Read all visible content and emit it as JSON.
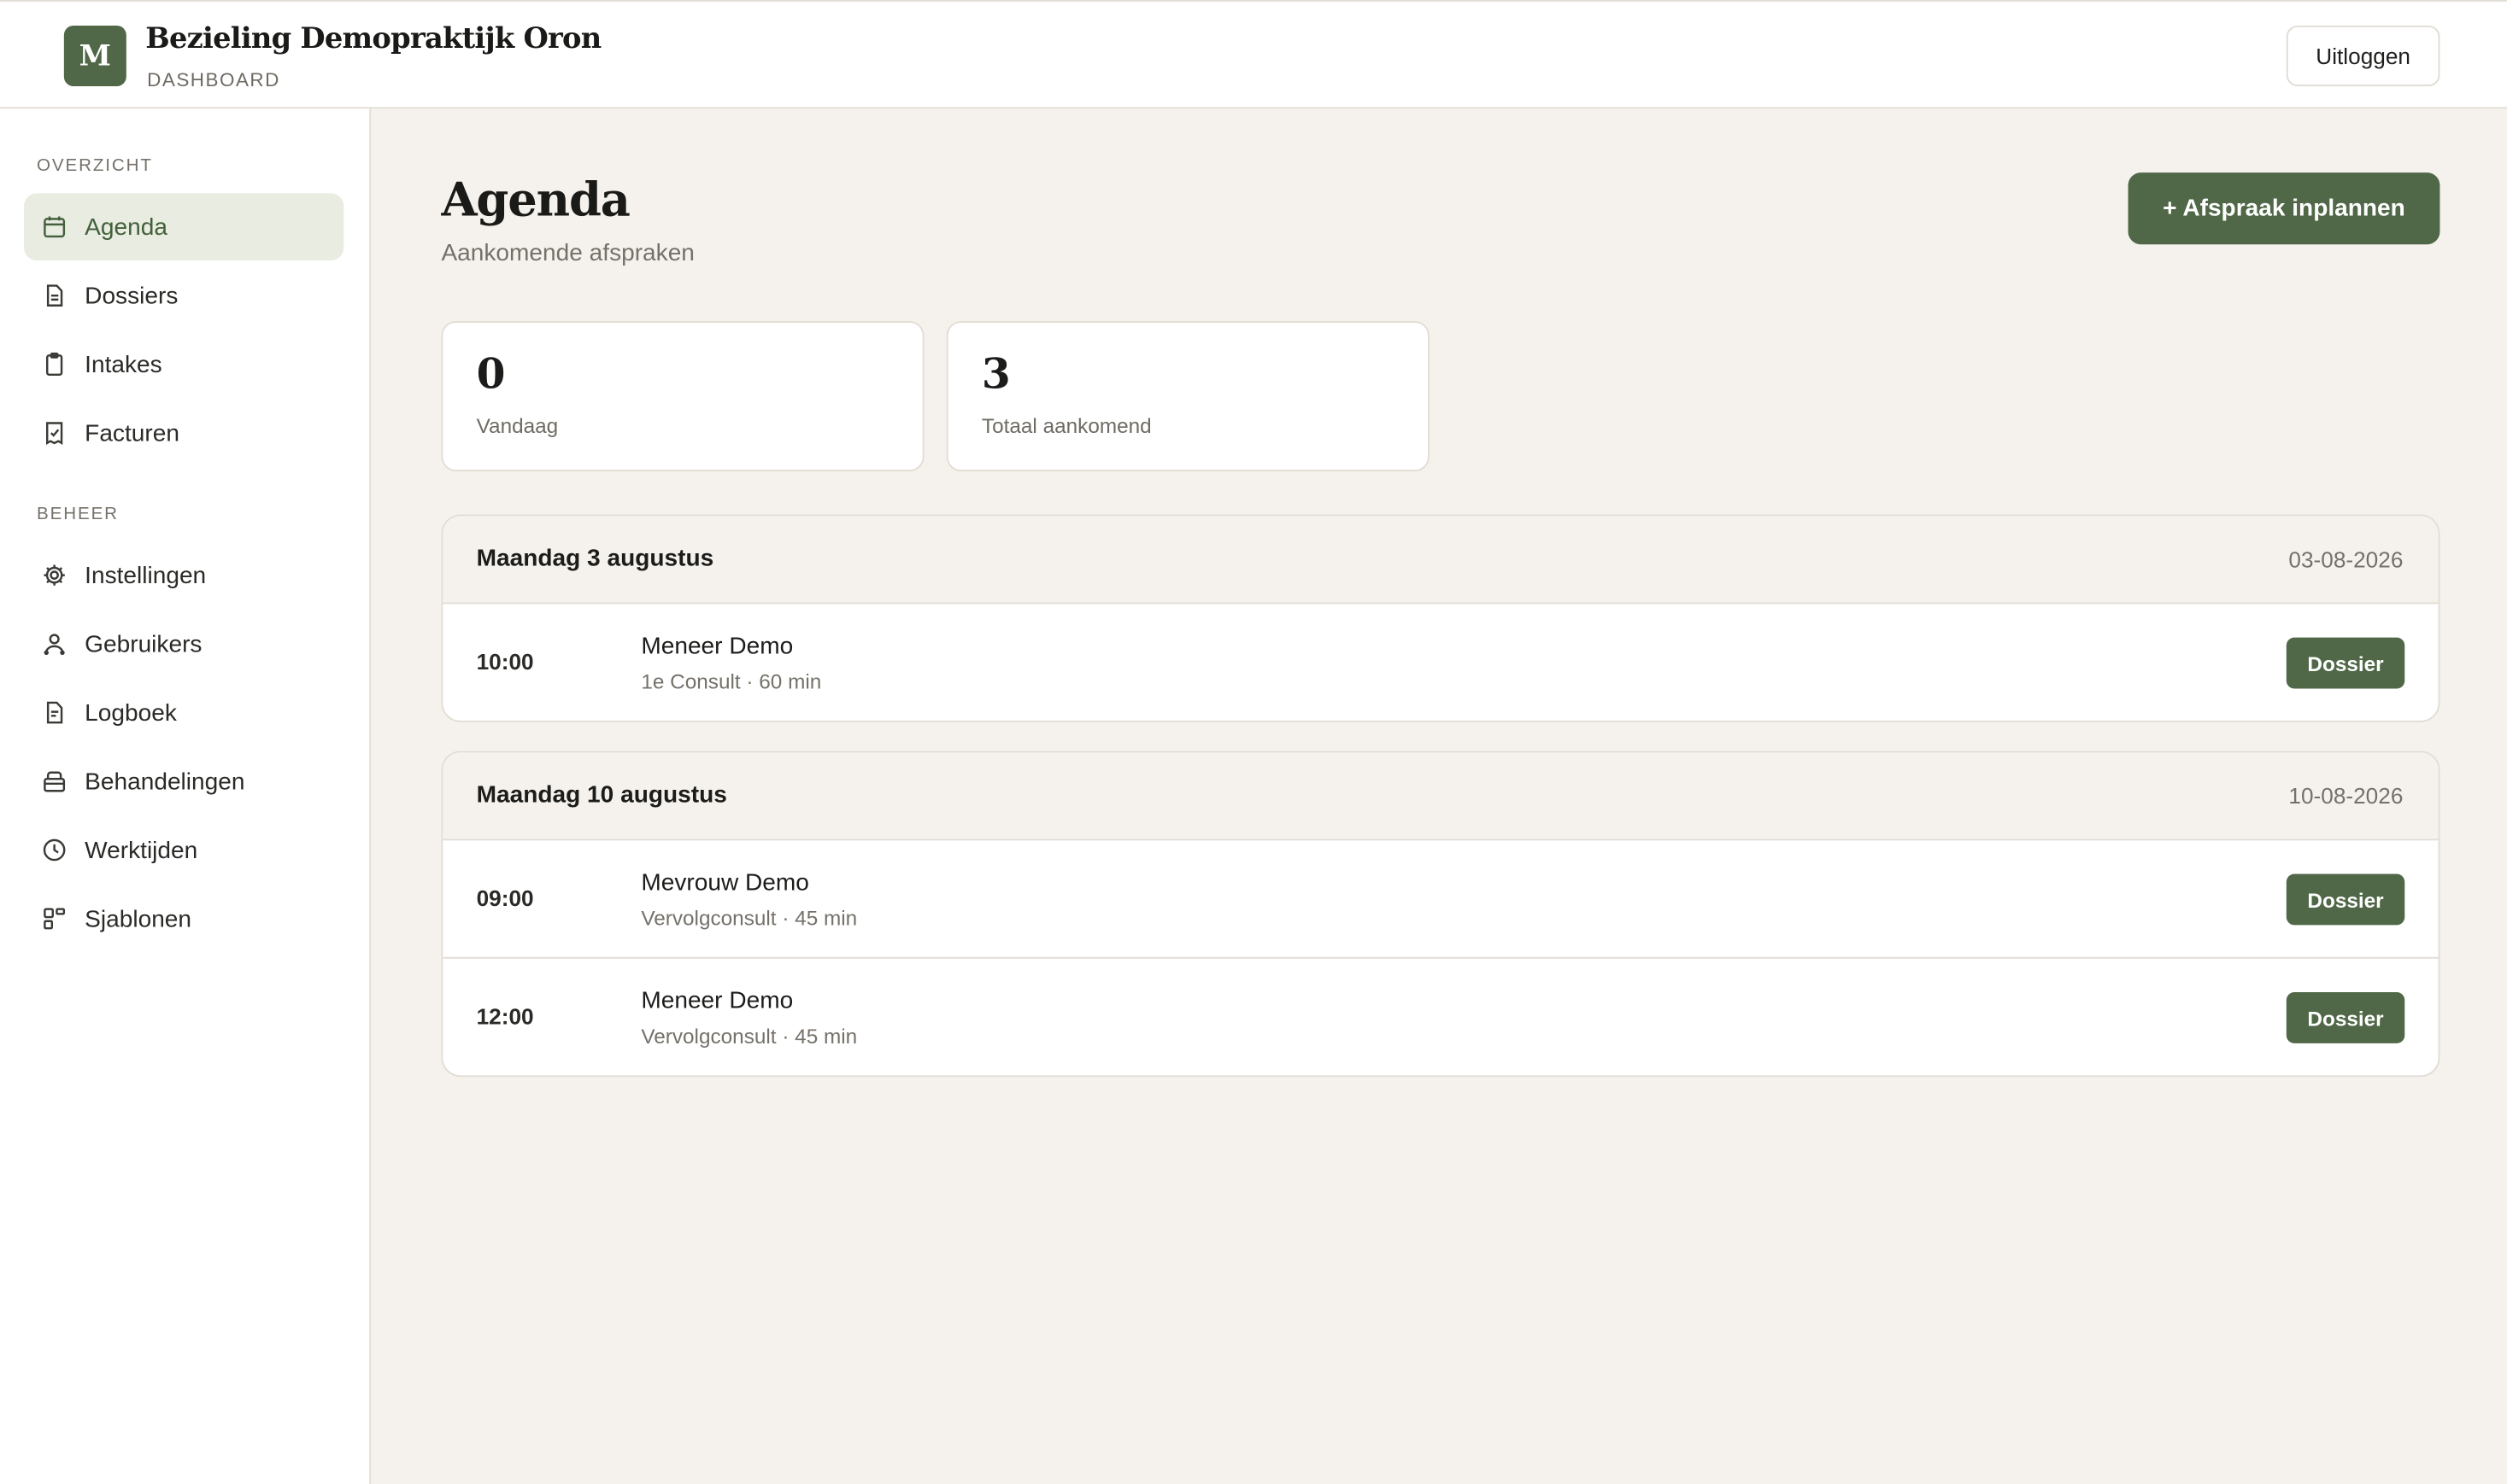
{
  "app": {
    "logo_letter": "M",
    "title": "Bezieling Demopraktijk Oron",
    "subtitle": "DASHBOARD",
    "logout_label": "Uitloggen"
  },
  "sidebar": {
    "section_overview": "OVERZICHT",
    "section_admin": "BEHEER",
    "items": [
      {
        "label": "Agenda",
        "icon": "calendar-icon",
        "active": true
      },
      {
        "label": "Dossiers",
        "icon": "file-icon"
      },
      {
        "label": "Intakes",
        "icon": "clipboard-icon"
      },
      {
        "label": "Facturen",
        "icon": "receipt-icon"
      },
      {
        "label": "Instellingen",
        "icon": "gear-icon"
      },
      {
        "label": "Gebruikers",
        "icon": "users-icon"
      },
      {
        "label": "Logboek",
        "icon": "log-icon"
      },
      {
        "label": "Behandelingen",
        "icon": "treatment-icon"
      },
      {
        "label": "Werktijden",
        "icon": "clock-icon"
      },
      {
        "label": "Sjablonen",
        "icon": "templates-icon"
      }
    ]
  },
  "main": {
    "title": "Agenda",
    "subtitle": "Aankomende afspraken",
    "cta_label": "+ Afspraak inplannen",
    "stats": [
      {
        "value": "0",
        "label": "Vandaag"
      },
      {
        "value": "3",
        "label": "Totaal aankomend"
      }
    ],
    "days": [
      {
        "title": "Maandag 3 augustus",
        "date": "03-08-2026",
        "appointments": [
          {
            "time": "10:00",
            "name": "Meneer Demo",
            "meta": "1e Consult · 60 min",
            "button": "Dossier"
          }
        ]
      },
      {
        "title": "Maandag 10 augustus",
        "date": "10-08-2026",
        "appointments": [
          {
            "time": "09:00",
            "name": "Mevrouw Demo",
            "meta": "Vervolgconsult · 45 min",
            "button": "Dossier"
          },
          {
            "time": "12:00",
            "name": "Meneer Demo",
            "meta": "Vervolgconsult · 45 min",
            "button": "Dossier"
          }
        ]
      }
    ]
  },
  "colors": {
    "accent": "#506847",
    "active_bg": "#e8ece1",
    "page_bg": "#f5f2ed"
  }
}
